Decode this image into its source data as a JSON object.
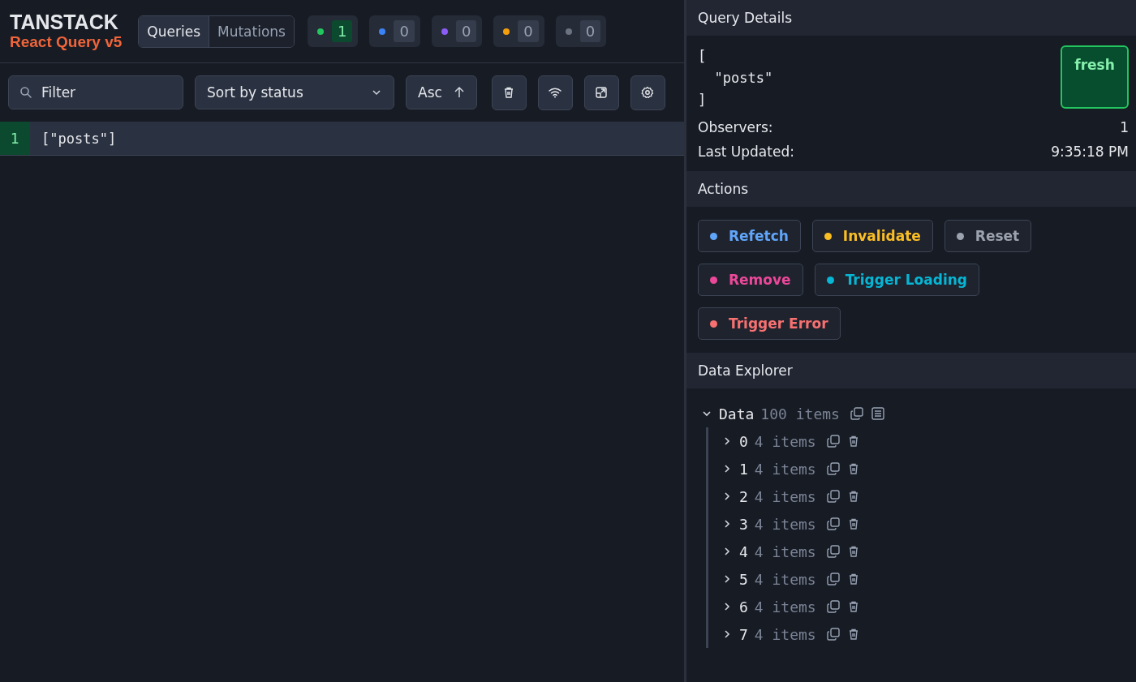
{
  "brand": {
    "name": "TANSTACK",
    "subtitle": "React Query v5"
  },
  "tabs": [
    {
      "label": "Queries",
      "selected": true
    },
    {
      "label": "Mutations",
      "selected": false
    }
  ],
  "status_counts": [
    {
      "color": "#22c55e",
      "count": "1",
      "active": true
    },
    {
      "color": "#3b82f6",
      "count": "0",
      "active": false
    },
    {
      "color": "#8b5cf6",
      "count": "0",
      "active": false
    },
    {
      "color": "#f59e0b",
      "count": "0",
      "active": false
    },
    {
      "color": "#6b7280",
      "count": "0",
      "active": false
    }
  ],
  "filter": {
    "placeholder": "Filter"
  },
  "sort": {
    "value": "Sort by status"
  },
  "order": {
    "label": "Asc"
  },
  "queries": [
    {
      "observers": "1",
      "key": "[\"posts\"]",
      "selected": true
    }
  ],
  "details": {
    "title": "Query Details",
    "key_lines": [
      "[",
      "  \"posts\"",
      "]"
    ],
    "status": "fresh",
    "rows": [
      {
        "label": "Observers:",
        "value": "1"
      },
      {
        "label": "Last Updated:",
        "value": "9:35:18 PM"
      }
    ]
  },
  "actions": {
    "title": "Actions",
    "buttons": [
      {
        "label": "Refetch",
        "color": "#60a5fa"
      },
      {
        "label": "Invalidate",
        "color": "#fbbf24"
      },
      {
        "label": "Reset",
        "color": "#9ca3af"
      },
      {
        "label": "Remove",
        "color": "#ec4899"
      },
      {
        "label": "Trigger Loading",
        "color": "#06b6d4"
      },
      {
        "label": "Trigger Error",
        "color": "#f87171"
      }
    ]
  },
  "explorer": {
    "title": "Data Explorer",
    "root": {
      "label": "Data",
      "count": "100 items",
      "expanded": true,
      "children": [
        {
          "label": "0",
          "count": "4 items",
          "expanded": false
        },
        {
          "label": "1",
          "count": "4 items",
          "expanded": false
        },
        {
          "label": "2",
          "count": "4 items",
          "expanded": false
        },
        {
          "label": "3",
          "count": "4 items",
          "expanded": false
        },
        {
          "label": "4",
          "count": "4 items",
          "expanded": false
        },
        {
          "label": "5",
          "count": "4 items",
          "expanded": false
        },
        {
          "label": "6",
          "count": "4 items",
          "expanded": false
        },
        {
          "label": "7",
          "count": "4 items",
          "expanded": false
        }
      ]
    }
  }
}
